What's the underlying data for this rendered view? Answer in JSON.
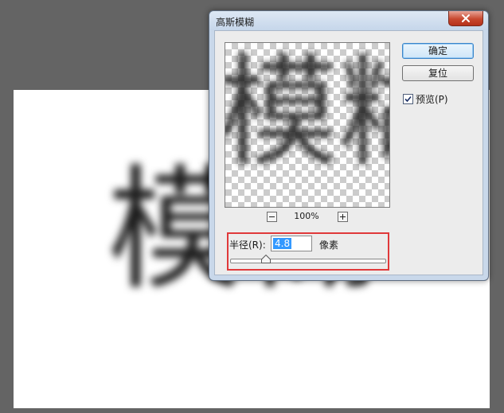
{
  "background": {
    "blur_text": "模糊"
  },
  "dialog": {
    "title": "高斯模糊",
    "buttons": {
      "ok_label": "确定",
      "reset_label": "复位"
    },
    "preview_option": {
      "label": "预览(P)",
      "checked": true
    },
    "preview": {
      "blur_text": "模糊",
      "zoom_level": "100%"
    },
    "radius": {
      "label": "半径(R):",
      "value": "4.8",
      "unit": "像素",
      "slider_fraction": 0.23
    }
  },
  "colors": {
    "workspace": "#646464",
    "highlight_border": "#e0393a",
    "selection": "#3399ff",
    "close_button": "#c8482f"
  }
}
